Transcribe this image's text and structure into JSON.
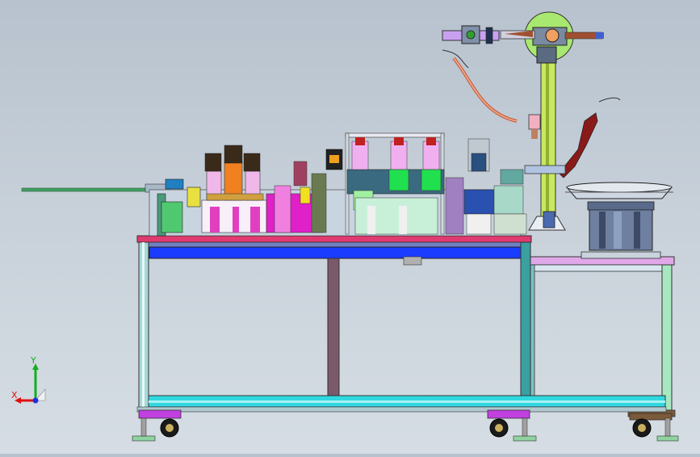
{
  "viewport": {
    "background_top": "#b7c2ce",
    "background_bottom": "#d6dde4"
  },
  "triad": {
    "x_label": "X",
    "y_label": "Y",
    "x_color": "#e01010",
    "y_color": "#10b020",
    "z_color": "#2030e0"
  },
  "colors": {
    "frame_cyan": "#8fd3d6",
    "frame_blue": "#1a3cff",
    "magenta": "#e020c8",
    "green": "#20e050",
    "yellow_green": "#c8e040",
    "brown": "#b06040"
  }
}
